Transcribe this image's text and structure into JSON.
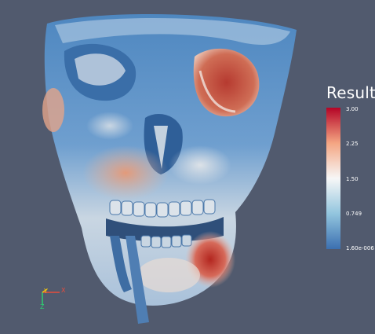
{
  "scalar_bar": {
    "title": "Result",
    "ticks": [
      "3.00",
      "2.25",
      "1.50",
      "0.749",
      "1.60e-006"
    ],
    "colors": {
      "high": "#b40426",
      "mid_high": "#f4a582",
      "mid": "#f7f7f7",
      "mid_low": "#92c5de",
      "low": "#3b6fb0"
    }
  },
  "orientation_axes": {
    "x_label": "X",
    "y_label": "Y",
    "z_label": "Z",
    "x_color": "#e74c3c",
    "y_color": "#f1c40f",
    "z_color": "#2ecc71"
  },
  "background_color": "#515a6e"
}
